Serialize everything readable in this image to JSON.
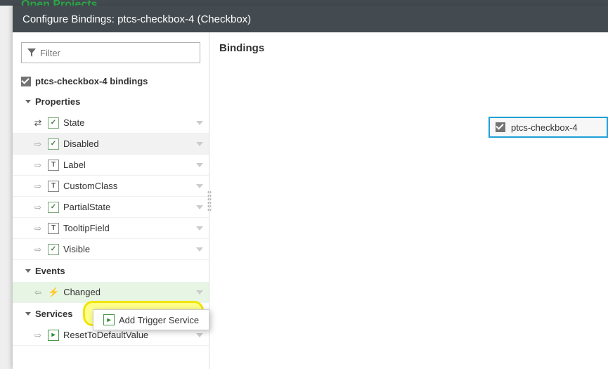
{
  "background": {
    "nav_hint": "Open Projects"
  },
  "dialog": {
    "title": "Configure Bindings: ptcs-checkbox-4 (Checkbox)"
  },
  "filter": {
    "placeholder": "Filter"
  },
  "tree": {
    "root_label": "ptcs-checkbox-4 bindings",
    "properties_label": "Properties",
    "events_label": "Events",
    "services_label": "Services",
    "properties": [
      {
        "label": "State"
      },
      {
        "label": "Disabled"
      },
      {
        "label": "Label"
      },
      {
        "label": "CustomClass"
      },
      {
        "label": "PartialState"
      },
      {
        "label": "TooltipField"
      },
      {
        "label": "Visible"
      }
    ],
    "events": [
      {
        "label": "Changed"
      }
    ],
    "services": [
      {
        "label": "ResetToDefaultValue"
      }
    ]
  },
  "context_menu": {
    "add_trigger_label": "Add Trigger Service"
  },
  "right": {
    "heading": "Bindings",
    "node_label": "ptcs-checkbox-4"
  }
}
